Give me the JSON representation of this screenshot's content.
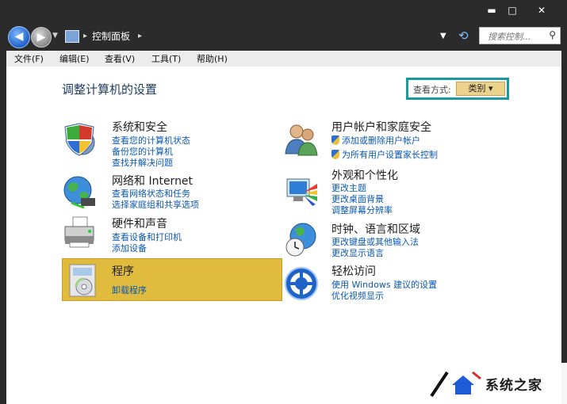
{
  "window": {
    "minimize_label": "▬",
    "maximize_label": "□",
    "close_label": "✕"
  },
  "address": {
    "breadcrumb": "控制面板",
    "search_placeholder": "搜索控制...",
    "back_glyph": "◀",
    "forward_glyph": "▶"
  },
  "menu": {
    "items": [
      "文件(F)",
      "编辑(E)",
      "查看(V)",
      "工具(T)",
      "帮助(H)"
    ]
  },
  "page": {
    "title": "调整计算机的设置",
    "viewby_label": "查看方式:",
    "viewby_value": "类别 ▾"
  },
  "categories": [
    {
      "title": "系统和安全",
      "links": [
        "查看您的计算机状态",
        "备份您的计算机",
        "查找并解决问题"
      ]
    },
    {
      "title": "网络和 Internet",
      "links": [
        "查看网络状态和任务",
        "选择家庭组和共享选项"
      ]
    },
    {
      "title": "硬件和声音",
      "links": [
        "查看设备和打印机",
        "添加设备"
      ]
    },
    {
      "title": "程序",
      "links": [
        "卸载程序"
      ]
    },
    {
      "title": "用户帐户和家庭安全",
      "links": [
        "添加或删除用户帐户",
        "为所有用户设置家长控制"
      ]
    },
    {
      "title": "外观和个性化",
      "links": [
        "更改主题",
        "更改桌面背景",
        "调整屏幕分辨率"
      ]
    },
    {
      "title": "时钟、语言和区域",
      "links": [
        "更改键盘或其他输入法",
        "更改显示语言"
      ]
    },
    {
      "title": "轻松访问",
      "links": [
        "使用 Windows 建议的设置",
        "优化视频显示"
      ]
    }
  ],
  "watermark": {
    "text": "系统之家"
  },
  "icons": {
    "security": "shield-icon",
    "network": "globe-network-icon",
    "hardware": "printer-icon",
    "programs": "programs-disc-icon",
    "users": "users-icon",
    "appearance": "monitor-palette-icon",
    "clock": "globe-clock-icon",
    "access": "accessibility-icon"
  }
}
